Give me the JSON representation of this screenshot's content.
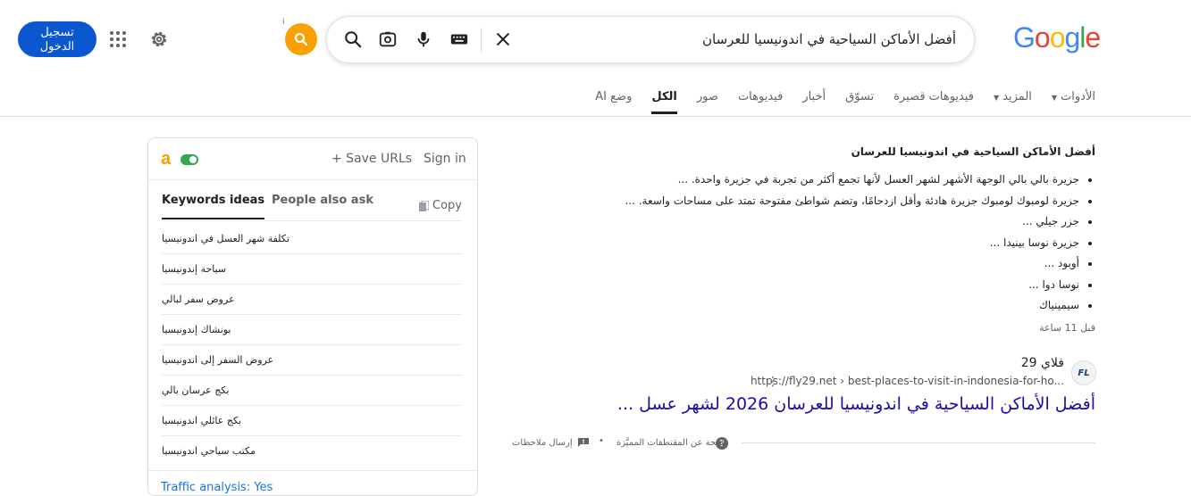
{
  "header": {
    "signin_label": "تسجيل الدخول",
    "search_query": "أفضل الأماكن السياحية في اندونيسيا للعرسان",
    "logo_text": [
      "G",
      "o",
      "o",
      "g",
      "l",
      "e"
    ],
    "logo_colors": [
      "#4285f4",
      "#ea4335",
      "#fbbc05",
      "#4285f4",
      "#34a853",
      "#ea4335"
    ],
    "ext_info": "i"
  },
  "tabs": [
    {
      "label": "وضع AI"
    },
    {
      "label": "الكل",
      "active": true
    },
    {
      "label": "صور"
    },
    {
      "label": "فيديوهات"
    },
    {
      "label": "أخبار"
    },
    {
      "label": "تسوّق"
    },
    {
      "label": "فيديوهات قصيرة"
    },
    {
      "label": "المزيد",
      "caret": true
    },
    {
      "label": "الأدوات",
      "caret": true
    }
  ],
  "snippet": {
    "title": "أفضل الأماكن السياحية في اندونيسيا للعرسان",
    "bullets": [
      "جزيرة بالي بالي الوجهة الأشهر لشهر العسل لأنها تجمع أكثر من تجربة في جزيرة واحدة. ...",
      "جزيرة لومبوك لومبوك جزيرة هادئة وأقل ازدحامًا، وتضم شواطئ مفتوحة تمتد على مساحات واسعة. ...",
      "جزر جيلي ...",
      "جزيرة نوسا بينيدا ...",
      "أوبود ...",
      "نوسا دوا ...",
      "سيمينياك"
    ],
    "time_ago": "قبل 11 ساعة"
  },
  "result": {
    "favicon_text": "FL",
    "site_name": "فلاي 29",
    "url": "https://fly29.net › best-places-to-visit-in-indonesia-for-ho...",
    "title": "أفضل الأماكن السياحية في اندونيسيا للعرسان 2026 لشهر عسل ...",
    "kebab": "⋮"
  },
  "feedback": {
    "about_label": "لمحة عن المقتطفات المميَّزة",
    "dot": "•",
    "send_label": "إرسال ملاحظات",
    "help_glyph": "?"
  },
  "panel": {
    "logo": "a",
    "save_urls": "+ Save URLs",
    "signin": "Sign in",
    "tab_keywords": "Keywords ideas",
    "tab_people": "People also ask",
    "copy": "Copy",
    "keywords": [
      "تكلفة شهر العسل في اندونيسيا",
      "سياحة إندونيسيا",
      "عروض سفر لبالي",
      "بونشاك إندونيسيا",
      "عروض السفر إلى اندونيسيا",
      "بكج عرسان بالي",
      "بكج عائلي اندونيسيا",
      "مكتب سياحي اندونيسيا"
    ],
    "footer": "Traffic analysis: Yes"
  }
}
